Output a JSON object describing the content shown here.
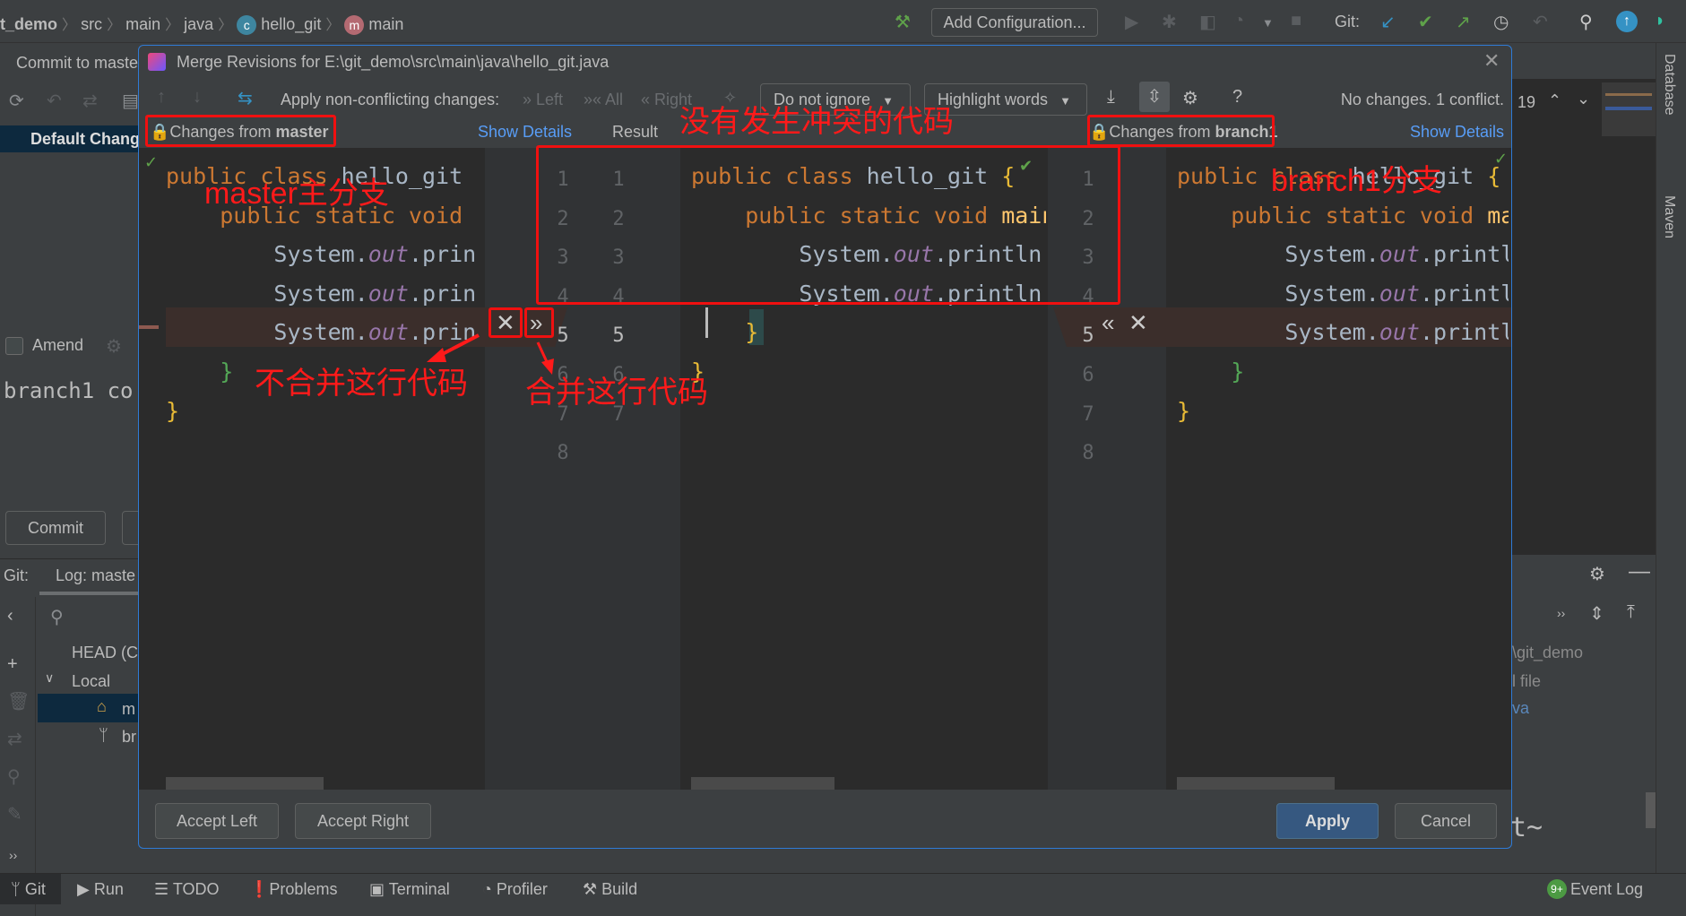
{
  "topbar": {
    "breadcrumbs": [
      "t_demo",
      "src",
      "main",
      "java",
      "hello_git",
      "main"
    ],
    "add_config": "Add Configuration...",
    "git_label": "Git:"
  },
  "left_panel": {
    "tab": "Commit to maste",
    "changelist": "Default Chang",
    "amend": "Amend",
    "message": "branch1 co",
    "commit_btn": "Commit",
    "git_label": "Git:",
    "log_tab": "Log: maste",
    "tree": [
      "HEAD (C",
      "Local",
      "m",
      "br"
    ]
  },
  "right_panel": {
    "line_count": "19",
    "tree": [
      "\\git_demo",
      "l file",
      "va"
    ],
    "console": "t~",
    "tool_windows": [
      "Database",
      "Maven"
    ]
  },
  "status_bar": {
    "items": [
      "Git",
      "Run",
      "TODO",
      "Problems",
      "Terminal",
      "Profiler",
      "Build"
    ],
    "event_log": "Event Log",
    "event_badge": "9+"
  },
  "dialog": {
    "title": "Merge Revisions for E:\\git_demo\\src\\main\\java\\hello_git.java",
    "toolbar": {
      "apply_label": "Apply non-conflicting changes:",
      "left": "Left",
      "all": "All",
      "right": "Right",
      "ignore": "Do not ignore",
      "highlight": "Highlight words",
      "status": "No changes. 1 conflict."
    },
    "headers": {
      "left_prefix": "Changes from ",
      "left_branch": "master",
      "show_details": "Show Details",
      "result": "Result",
      "right_prefix": "Changes from ",
      "right_branch": "branch1"
    },
    "left_code": [
      [
        [
          "kw",
          "public class "
        ],
        [
          "p",
          "hello_git"
        ]
      ],
      [
        [
          "i",
          "    "
        ],
        [
          "kw",
          "public static void"
        ]
      ],
      [
        [
          "i",
          "        "
        ],
        [
          "p",
          "System."
        ],
        [
          "fld",
          "out"
        ],
        [
          "p",
          ".prin"
        ]
      ],
      [
        [
          "i",
          "        "
        ],
        [
          "p",
          "System."
        ],
        [
          "fld",
          "out"
        ],
        [
          "p",
          ".prin"
        ]
      ],
      [
        [
          "i",
          "        "
        ],
        [
          "p",
          "System."
        ],
        [
          "fld",
          "out"
        ],
        [
          "p",
          ".prin"
        ]
      ],
      [
        [
          "i",
          "    "
        ],
        [
          "bg",
          "}"
        ]
      ],
      [
        [
          "by",
          "}"
        ]
      ]
    ],
    "center_code": [
      [
        [
          "kw",
          "public class "
        ],
        [
          "p",
          "hello_git "
        ],
        [
          "by",
          "{"
        ]
      ],
      [
        [
          "i",
          "    "
        ],
        [
          "kw",
          "public static void "
        ],
        [
          "fn",
          "main"
        ]
      ],
      [
        [
          "i",
          "        "
        ],
        [
          "p",
          "System."
        ],
        [
          "fld",
          "out"
        ],
        [
          "p",
          ".println"
        ],
        [
          "by",
          "("
        ]
      ],
      [
        [
          "i",
          "        "
        ],
        [
          "p",
          "System."
        ],
        [
          "fld",
          "out"
        ],
        [
          "p",
          ".println"
        ],
        [
          "by",
          "("
        ]
      ],
      [
        [
          "i",
          "    "
        ],
        [
          "by",
          "}"
        ]
      ],
      [
        [
          "by",
          "}"
        ]
      ]
    ],
    "right_code": [
      [
        [
          "kw",
          "public class "
        ],
        [
          "p",
          "hello_git "
        ],
        [
          "by",
          "{"
        ]
      ],
      [
        [
          "i",
          "    "
        ],
        [
          "kw",
          "public static void "
        ],
        [
          "fn",
          "ma"
        ]
      ],
      [
        [
          "i",
          "        "
        ],
        [
          "p",
          "System."
        ],
        [
          "fld",
          "out"
        ],
        [
          "p",
          ".printl"
        ]
      ],
      [
        [
          "i",
          "        "
        ],
        [
          "p",
          "System."
        ],
        [
          "fld",
          "out"
        ],
        [
          "p",
          ".printl"
        ]
      ],
      [
        [
          "i",
          "        "
        ],
        [
          "p",
          "System."
        ],
        [
          "fld",
          "out"
        ],
        [
          "p",
          ".printl"
        ]
      ],
      [
        [
          "i",
          "    "
        ],
        [
          "bg",
          "}"
        ]
      ],
      [
        [
          "by",
          "}"
        ]
      ]
    ],
    "gutter_left_numbers": [
      "1",
      "2",
      "3",
      "4",
      "5",
      "6",
      "7",
      "8"
    ],
    "gutter_result_numbers": [
      "1",
      "2",
      "3",
      "4",
      "5",
      "6",
      "7"
    ],
    "gutter_right_numbers": [
      "1",
      "2",
      "3",
      "4",
      "5",
      "6",
      "7",
      "8"
    ],
    "conflict_line": 5,
    "buttons": {
      "accept_left": "Accept Left",
      "accept_right": "Accept Right",
      "apply": "Apply",
      "cancel": "Cancel"
    }
  },
  "annotations": {
    "no_conflict": "没有发生冲突的代码",
    "master": "master主分支",
    "branch1": "branch1分支",
    "reject": "不合并这行代码",
    "accept": "合并这行代码"
  },
  "colors": {
    "accent": "#2f7bd6",
    "annotation": "#ff1a1a",
    "conflict_bg": "#3b2e2b"
  }
}
